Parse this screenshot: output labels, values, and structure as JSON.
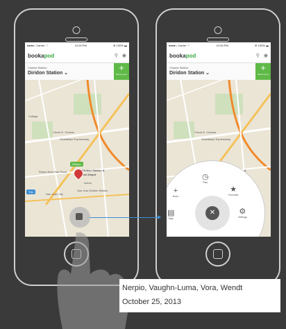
{
  "status": {
    "carrier": "●●●●○ Carrier ⌔",
    "time": "12:00 PM",
    "battery": "⊕ 100% ▬"
  },
  "app": {
    "logo_a": "booka",
    "logo_b": "pod"
  },
  "station": {
    "label": "Closest Station:",
    "name": "Diridon Station"
  },
  "book_button": {
    "label": "Book a pod"
  },
  "map_labels": {
    "trolley": "Trolley Cutoff",
    "chuck": "Chuck E. Cheese",
    "guadalupe": "Guadalupe Expressway",
    "diridon_tag": "Diridon",
    "diridon_station": "Diridon Station &",
    "taxi_depot": "Taxi Depot",
    "arena": "Arena",
    "san_jose": "San Jose Diridon Station",
    "park": "Park",
    "college": "College",
    "trip_tag": "Trip",
    "trip_text": "San Jose City",
    "depot": "Reyes New York Pizza"
  },
  "menu": {
    "book": "Book",
    "plan": "Plan",
    "favorites": "Favorites",
    "map": "Map",
    "settings": "Settings",
    "close": "✕"
  },
  "credit": {
    "authors": "Nerpio, Vaughn-Luma, Vora, Wendt",
    "date": "October 25, 2013"
  },
  "colors": {
    "accent_green": "#5fb947",
    "accent_blue": "#3e8ed4",
    "pin_red": "#d23a3a"
  }
}
